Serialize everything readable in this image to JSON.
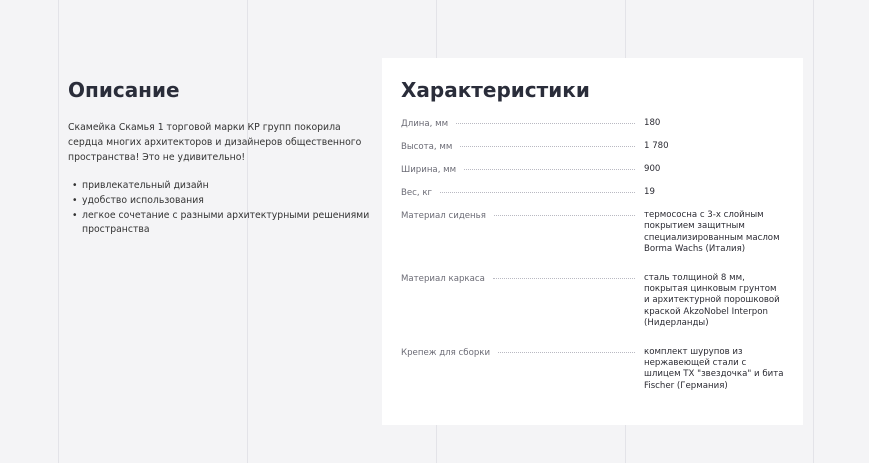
{
  "description": {
    "title": "Описание",
    "text": "Скамейка Скамья 1 торговой марки КР групп покорила сердца многих архитекторов и дизайнеров общественного пространства! Это не удивительно!",
    "bullets": [
      "привлекательный дизайн",
      "удобство использования",
      "легкое сочетание с разными архитектурными решениями пространства"
    ]
  },
  "characteristics": {
    "title": "Характеристики",
    "specs": [
      {
        "name": "Длина, мм",
        "value": "180"
      },
      {
        "name": "Высота, мм",
        "value": "1 780"
      },
      {
        "name": "Ширина, мм",
        "value": "900"
      },
      {
        "name": "Вес, кг",
        "value": "19"
      },
      {
        "name": "Материал сиденья",
        "value": "термососна с 3-х слойным покрытием защитным специализированным маслом Borma Wachs (Италия)"
      },
      {
        "name": "Материал каркаса",
        "value": "сталь толщиной 8 мм, покрытая цинковым грунтом и архитектурной порошковой краской AkzoNobel Interpon (Нидерланды)"
      },
      {
        "name": "Крепеж для сборки",
        "value": "комплект шурупов из нержавеющей стали с шлицем TX \"звездочка\" и бита Fischer (Германия)"
      }
    ]
  },
  "colors": {
    "background": "#f4f4f6",
    "card": "#ffffff",
    "heading": "#2a2d3a"
  }
}
